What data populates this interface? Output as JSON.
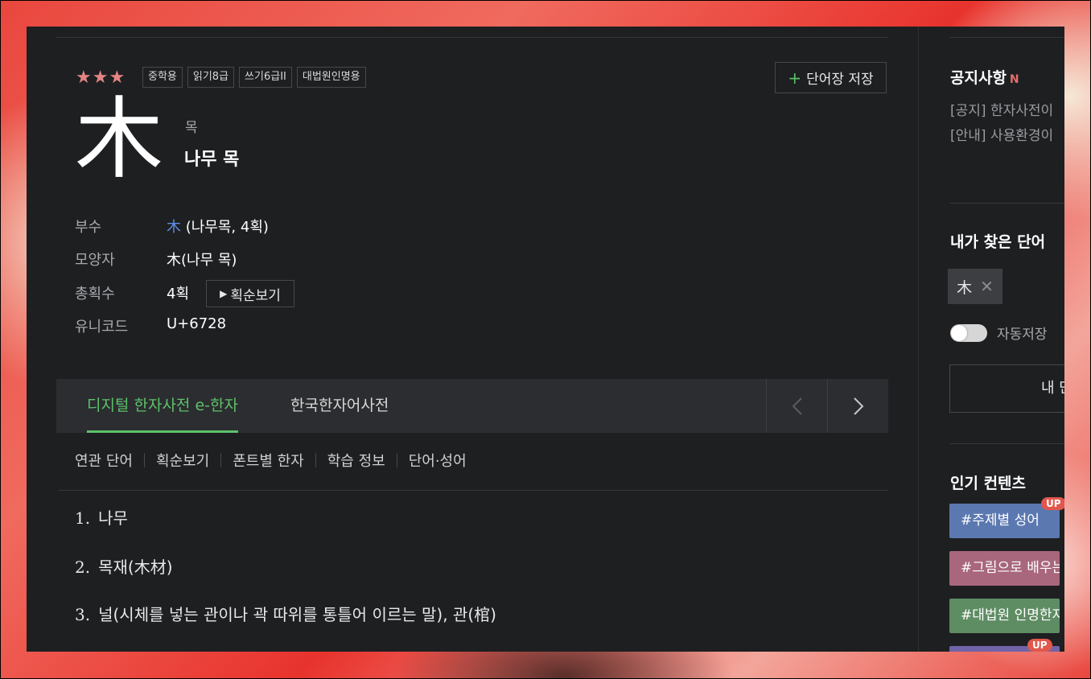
{
  "entry": {
    "stars": "★★★",
    "badges": [
      "중학용",
      "읽기8급",
      "쓰기6급II",
      "대법원인명용"
    ],
    "save_label": "단어장 저장",
    "character": "木",
    "reading": "목",
    "meaning": "나무 목"
  },
  "info": {
    "radical_label": "부수",
    "radical_char": "木",
    "radical_rest": " (나무목, 4획)",
    "shape_label": "모양자",
    "shape_value": "木(나무 목)",
    "strokes_label": "총획수",
    "strokes_value": "4획",
    "stroke_order_button": "획순보기",
    "unicode_label": "유니코드",
    "unicode_value": "U+6728"
  },
  "tabs": {
    "items": [
      "디지털 한자사전 e-한자",
      "한국한자어사전"
    ],
    "active": 0
  },
  "subnav": [
    "연관 단어",
    "획순보기",
    "폰트별 한자",
    "학습 정보",
    "단어·성어"
  ],
  "definitions": [
    {
      "num": "1.",
      "text": "나무"
    },
    {
      "num": "2.",
      "text": "목재(木材)"
    },
    {
      "num": "3.",
      "text": "널(시체를 넣는 관이나 곽 따위를 통틀어 이르는 말), 관(棺)"
    }
  ],
  "sidebar": {
    "notice_title": "공지사항",
    "notice_new": "N",
    "notices": [
      "[공지] 한자사전이",
      "[안내] 사용환경이"
    ],
    "recent_title": "내가 찾은 단어",
    "recent_chip": "木",
    "autosave_label": "자동저장",
    "autosave_on": false,
    "my_words_button": "내 단",
    "popular_title": "인기 컨텐츠",
    "tags": [
      {
        "label": "#주제별 성어",
        "color": "#5b78b0",
        "up": "UP"
      },
      {
        "label": "#그림으로 배우는",
        "color": "#a8677c",
        "up": ""
      },
      {
        "label": "#대법원 인명한자",
        "color": "#5e8c63",
        "up": ""
      },
      {
        "label": "",
        "color": "#7063a8",
        "up": "UP"
      }
    ]
  }
}
